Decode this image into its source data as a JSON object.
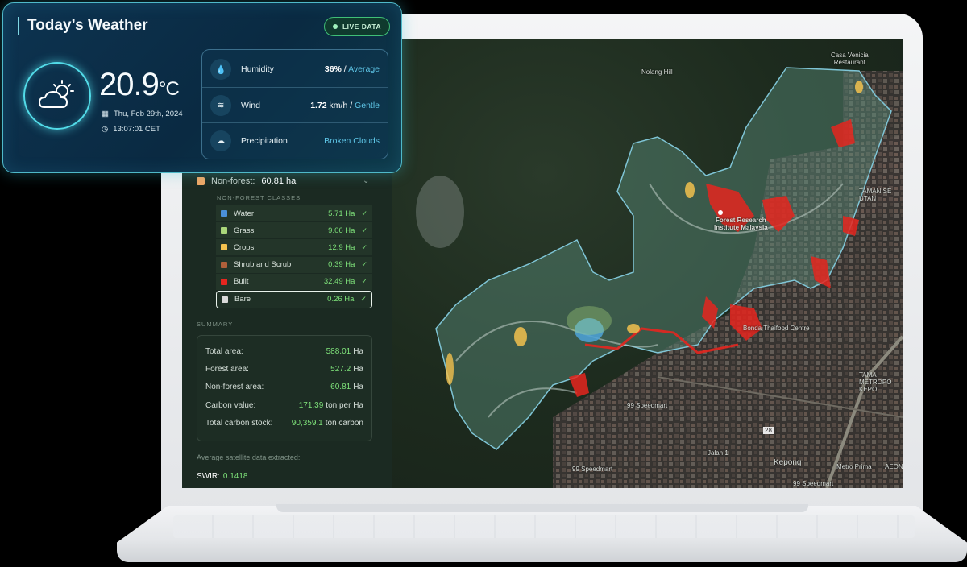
{
  "weather": {
    "title": "Today’s Weather",
    "live_label": "LIVE DATA",
    "temperature": "20.9",
    "temperature_unit": "°C",
    "date": "Thu, Feb 29th, 2024",
    "time": "13:07:01 CET",
    "details": [
      {
        "label": "Humidity",
        "value": "36%",
        "sep": " / ",
        "sub": "Average",
        "icon": "droplet-icon"
      },
      {
        "label": "Wind",
        "value": "1.72",
        "unit": " km/h",
        "sep": " / ",
        "sub": "Gentle",
        "icon": "wind-icon"
      },
      {
        "label": "Precipitation",
        "value": "",
        "sep": "",
        "sub": "Broken Clouds",
        "icon": "cloud-icon"
      }
    ]
  },
  "panel": {
    "non_forest_label": "Non-forest:",
    "non_forest_value": "60.81 ha",
    "classes_title": "NON-FOREST CLASSES",
    "classes": [
      {
        "name": "Water",
        "value": "5.71 Ha",
        "color": "#4a90d9"
      },
      {
        "name": "Grass",
        "value": "9.06 Ha",
        "color": "#a9d67a"
      },
      {
        "name": "Crops",
        "value": "12.9 Ha",
        "color": "#f2c14e"
      },
      {
        "name": "Shrub and Scrub",
        "value": "0.39 Ha",
        "color": "#b0603a"
      },
      {
        "name": "Built",
        "value": "32.49 Ha",
        "color": "#e5261f"
      },
      {
        "name": "Bare",
        "value": "0.26 Ha",
        "color": "#d9d9d9"
      }
    ],
    "summary_title": "SUMMARY",
    "summary": [
      {
        "label": "Total area:",
        "value": "588.01",
        "unit": "Ha"
      },
      {
        "label": "Forest area:",
        "value": "527.2",
        "unit": "Ha"
      },
      {
        "label": "Non-forest area:",
        "value": "60.81",
        "unit": "Ha"
      },
      {
        "label": "Carbon value:",
        "value": "171.39",
        "unit": "ton per Ha"
      },
      {
        "label": "Total carbon stock:",
        "value": "90,359.1",
        "unit": "ton carbon"
      }
    ],
    "avg_label": "Average satellite data extracted:",
    "swir_label": "SWIR:",
    "swir_value": "0.1418"
  },
  "map": {
    "labels": {
      "nolang_hill": "Nolang Hill",
      "casa": "Casa Venicia\nRestaurant",
      "institute": "Forest Research\nInstitute Malaysia",
      "bonda": "Bonda Thaifood Centre",
      "speedmart1": "99 Speedmart",
      "speedmart2": "99 Speedmart",
      "speedmart3": "99 Speedmart",
      "kepong": "Kepong",
      "jalan": "Jalan 1",
      "taman1": "TAMAN SE\nUTAN",
      "taman2": "TAMA\nMETROPO\nKEPO",
      "metro": "Metro Prima",
      "aeon": "AEON",
      "road28": "28"
    },
    "controls": [
      "+",
      "−",
      "compass-icon",
      "locate-icon",
      "crop-icon",
      "trash-icon"
    ]
  }
}
